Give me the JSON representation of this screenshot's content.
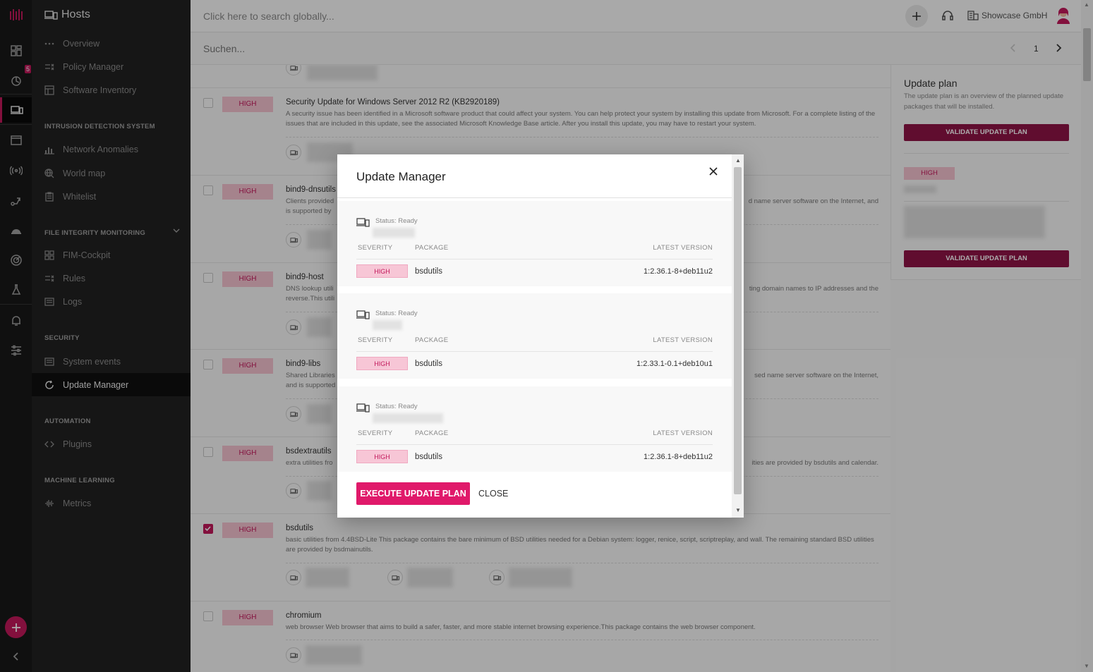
{
  "rail": {
    "notification_count": "5"
  },
  "nav": {
    "title": "Hosts",
    "items_top": [
      "Overview",
      "Policy Manager",
      "Software Inventory"
    ],
    "section_ids": "INTRUSION DETECTION SYSTEM",
    "items_ids": [
      "Network Anomalies",
      "World map",
      "Whitelist"
    ],
    "section_fim": "FILE INTEGRITY MONITORING",
    "items_fim": [
      "FIM-Cockpit",
      "Rules",
      "Logs"
    ],
    "section_security": "SECURITY",
    "items_security": [
      "System events",
      "Update Manager"
    ],
    "section_automation": "AUTOMATION",
    "items_automation": [
      "Plugins"
    ],
    "section_ml": "MACHINE LEARNING",
    "items_ml": [
      "Metrics"
    ]
  },
  "topbar": {
    "search_placeholder": "Click here to search globally...",
    "company": "Showcase GmbH"
  },
  "subbar": {
    "search_placeholder": "Suchen...",
    "page": "1"
  },
  "list": [
    {
      "severity": "HIGH",
      "name": "Security Update for Windows Server 2012 R2 (KB2920189)",
      "description": "A security issue has been identified in a Microsoft software product that could affect your system. You can help protect your system by installing this update from Microsoft. For a complete listing of the issues that are included in this update, see the associated Microsoft Knowledge Base article. After you install this update, you may have to restart your system.",
      "checked": false
    },
    {
      "severity": "HIGH",
      "name": "bind9-dnsutils",
      "description": "Clients provided",
      "description_right": "d name server software on the Internet, and",
      "description_2": "is supported by",
      "checked": false
    },
    {
      "severity": "HIGH",
      "name": "bind9-host",
      "description": "DNS lookup utili",
      "description_right": "ting domain names to IP addresses and the",
      "description_2": "reverse.This utili",
      "checked": false
    },
    {
      "severity": "HIGH",
      "name": "bind9-libs",
      "description": "Shared Libraries",
      "description_right": "sed name server software on the Internet,",
      "description_2": "and is supported",
      "checked": false
    },
    {
      "severity": "HIGH",
      "name": "bsdextrautils",
      "description": "extra utilities fro",
      "description_right": "ities are provided by bsdutils and calendar.",
      "checked": false
    },
    {
      "severity": "HIGH",
      "name": "bsdutils",
      "description": "basic utilities from 4.4BSD-Lite This package contains the bare minimum of BSD utilities needed for a Debian system: logger, renice, script, scriptreplay, and wall. The remaining standard BSD utilities are provided by bsdmainutils.",
      "checked": true
    },
    {
      "severity": "HIGH",
      "name": "chromium",
      "description": "web browser Web browser that aims to build a safer, faster, and more stable internet browsing experience.This package contains the web browser component.",
      "checked": false
    }
  ],
  "update_plan": {
    "title": "Update plan",
    "description": "The update plan is an overview of the planned update packages that will be installed.",
    "validate_label": "VALIDATE UPDATE PLAN",
    "severity": "HIGH"
  },
  "modal": {
    "title": "Update Manager",
    "status_label": "Status: Ready",
    "col_severity": "SEVERITY",
    "col_package": "PACKAGE",
    "col_version": "LATEST VERSION",
    "entries": [
      {
        "severity": "HIGH",
        "package": "bsdutils",
        "version": "1:2.36.1-8+deb11u2"
      },
      {
        "severity": "HIGH",
        "package": "bsdutils",
        "version": "1:2.33.1-0.1+deb10u1"
      },
      {
        "severity": "HIGH",
        "package": "bsdutils",
        "version": "1:2.36.1-8+deb11u2"
      }
    ],
    "execute_label": "EXECUTE UPDATE PLAN",
    "close_label": "CLOSE"
  },
  "colors": {
    "accent": "#c2185b",
    "execute": "#e0196a",
    "validate": "#8e1446"
  }
}
